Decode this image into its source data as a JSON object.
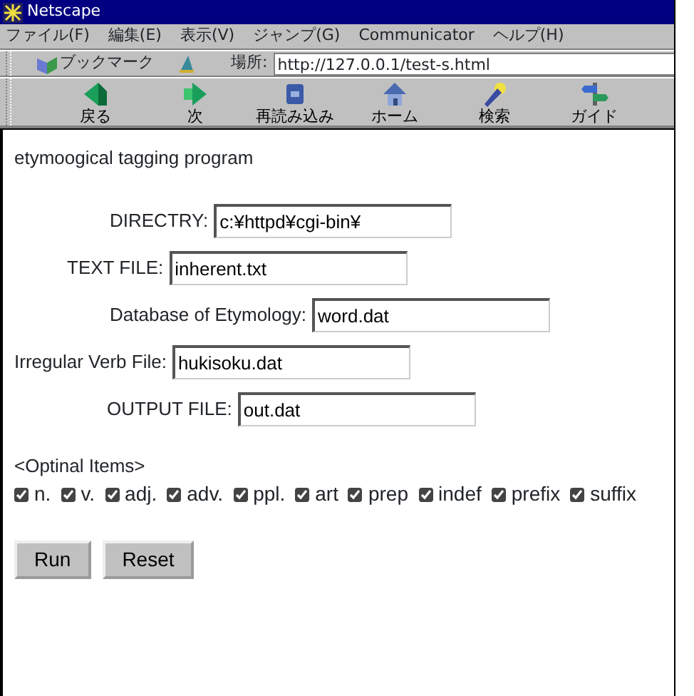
{
  "window": {
    "title": "Netscape"
  },
  "menu": [
    "ファイル(F)",
    "編集(E)",
    "表示(V)",
    "ジャンプ(G)",
    "Communicator",
    "ヘルプ(H)"
  ],
  "location_bar": {
    "bookmarks": "ブックマーク",
    "label": "場所:",
    "url": "http://127.0.0.1/test-s.html"
  },
  "toolbar": [
    {
      "kind": "back",
      "label": "戻る"
    },
    {
      "kind": "forward",
      "label": "次"
    },
    {
      "kind": "reload",
      "label": "再読み込み"
    },
    {
      "kind": "home",
      "label": "ホーム"
    },
    {
      "kind": "search",
      "label": "検索"
    },
    {
      "kind": "guide",
      "label": "ガイド"
    }
  ],
  "page": {
    "heading": "etymoogical tagging program",
    "fields": [
      {
        "label": "DIRECTRY:",
        "value": "c:¥httpd¥cgi-bin¥"
      },
      {
        "label": "TEXT FILE:",
        "value": "inherent.txt"
      },
      {
        "label": "Database of Etymology:",
        "value": "word.dat"
      },
      {
        "label": "Irregular Verb File:",
        "value": "hukisoku.dat"
      },
      {
        "label": "OUTPUT FILE:",
        "value": "out.dat"
      }
    ],
    "options_title": "<Optinal Items>",
    "options": [
      {
        "label": "n.",
        "checked": true
      },
      {
        "label": "v.",
        "checked": true
      },
      {
        "label": "adj.",
        "checked": true
      },
      {
        "label": "adv.",
        "checked": true
      },
      {
        "label": "ppl.",
        "checked": true
      },
      {
        "label": "art",
        "checked": true
      },
      {
        "label": "prep",
        "checked": true
      },
      {
        "label": "indef",
        "checked": true
      },
      {
        "label": "prefix",
        "checked": true
      },
      {
        "label": "suffix",
        "checked": true
      }
    ],
    "buttons": [
      "Run",
      "Reset"
    ]
  }
}
